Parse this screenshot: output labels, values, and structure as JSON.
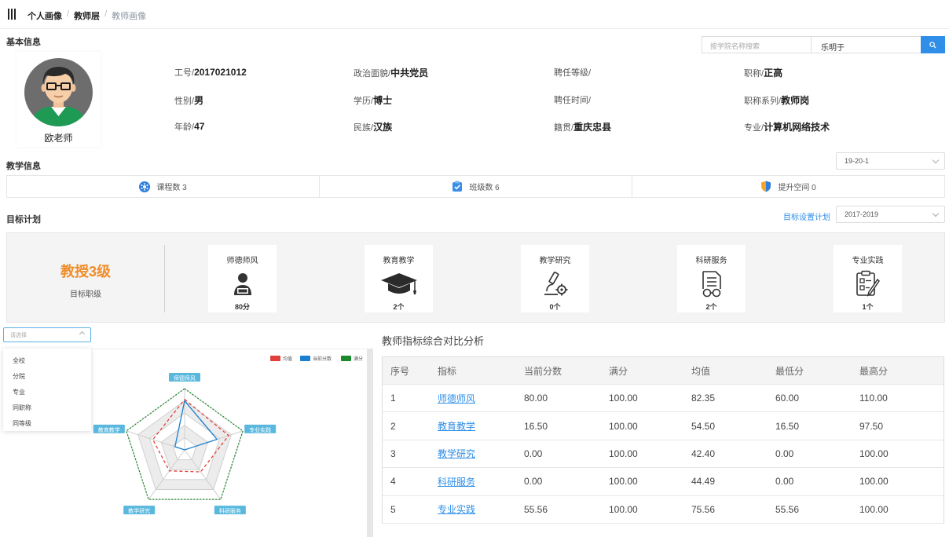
{
  "breadcrumb": {
    "items": [
      "个人画像",
      "教师层",
      "教师画像"
    ]
  },
  "basic": {
    "title": "基本信息",
    "search_college_placeholder": "按学院名称搜索",
    "search_name_value": "乐明于",
    "avatar_name": "欧老师",
    "fields": [
      {
        "label": "工号/",
        "value": "2017021012"
      },
      {
        "label": "政治面貌/",
        "value": "中共党员"
      },
      {
        "label": "聘任等级/",
        "value": ""
      },
      {
        "label": "职称/",
        "value": "正高"
      },
      {
        "label": "性别/",
        "value": "男"
      },
      {
        "label": "学历/",
        "value": "博士"
      },
      {
        "label": "聘任时间/",
        "value": ""
      },
      {
        "label": "职称系列/",
        "value": "教师岗"
      },
      {
        "label": "年龄/",
        "value": "47"
      },
      {
        "label": "民族/",
        "value": "汉族"
      },
      {
        "label": "籍贯/",
        "value": "重庆忠县"
      },
      {
        "label": "专业/",
        "value": "计算机网络技术"
      }
    ]
  },
  "teaching": {
    "title": "教学信息",
    "term": "19-20-1",
    "items": [
      {
        "label": "课程数 3",
        "icon": "course-icon"
      },
      {
        "label": "班级数 6",
        "icon": "class-icon"
      },
      {
        "label": "提升空间 0",
        "icon": "shield-icon"
      }
    ]
  },
  "goal": {
    "title": "目标计划",
    "link": "目标设置计划",
    "period": "2017-2019",
    "level": "教授3级",
    "level_label": "目标职级",
    "cards": [
      {
        "title": "师德师风",
        "value": "80分",
        "icon": "teacher-icon"
      },
      {
        "title": "教育教学",
        "value": "2个",
        "icon": "graduation-cap-icon"
      },
      {
        "title": "教学研究",
        "value": "0个",
        "icon": "microscope-icon"
      },
      {
        "title": "科研服务",
        "value": "2个",
        "icon": "research-doc-icon"
      },
      {
        "title": "专业实践",
        "value": "1个",
        "icon": "practice-icon"
      }
    ]
  },
  "scope": {
    "placeholder": "请选择",
    "options": [
      "全校",
      "分院",
      "专业",
      "同职称",
      "同等级"
    ]
  },
  "colors": {
    "accent": "#2f8fe8",
    "orange": "#f08c2a",
    "avg": "#e0403a",
    "current": "#1a7fd0",
    "full": "#1a8a2a"
  },
  "chart_data": {
    "type": "radar",
    "indicators": [
      "师德师风",
      "专业实践",
      "科研服务",
      "教学研究",
      "教育教学"
    ],
    "max": 100,
    "legend": [
      "均值",
      "当前分数",
      "满分"
    ],
    "series": [
      {
        "name": "均值",
        "values": [
          82.35,
          75.56,
          44.49,
          42.4,
          54.5
        ]
      },
      {
        "name": "当前分数",
        "values": [
          80,
          55.56,
          0,
          0,
          16.5
        ]
      },
      {
        "name": "满分",
        "values": [
          100,
          100,
          100,
          100,
          100
        ]
      }
    ]
  },
  "table": {
    "title": "教师指标综合对比分析",
    "headers": [
      "序号",
      "指标",
      "当前分数",
      "满分",
      "均值",
      "最低分",
      "最高分"
    ],
    "rows": [
      [
        "1",
        "师德师风",
        "80.00",
        "100.00",
        "82.35",
        "60.00",
        "110.00"
      ],
      [
        "2",
        "教育教学",
        "16.50",
        "100.00",
        "54.50",
        "16.50",
        "97.50"
      ],
      [
        "3",
        "教学研究",
        "0.00",
        "100.00",
        "42.40",
        "0.00",
        "100.00"
      ],
      [
        "4",
        "科研服务",
        "0.00",
        "100.00",
        "44.49",
        "0.00",
        "100.00"
      ],
      [
        "5",
        "专业实践",
        "55.56",
        "100.00",
        "75.56",
        "55.56",
        "100.00"
      ]
    ]
  }
}
